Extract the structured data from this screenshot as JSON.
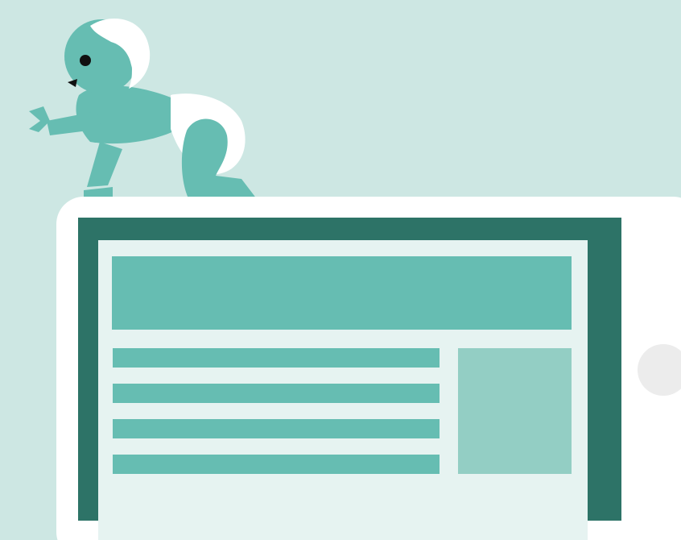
{
  "colors": {
    "background": "#cde7e3",
    "tablet_bezel": "#ffffff",
    "tablet_home_button": "#ececec",
    "screen_frame": "#2d7367",
    "page_background": "#e6f3f1",
    "content_blocks": "#66bdb2",
    "image_placeholder": "#93cec4",
    "baby_skin": "#66bdb2",
    "baby_hair_and_diaper": "#ffffff",
    "baby_features": "#111111"
  },
  "illustration": {
    "figure": "crawling-baby",
    "device": "tablet",
    "webpage_text_lines": 4
  }
}
